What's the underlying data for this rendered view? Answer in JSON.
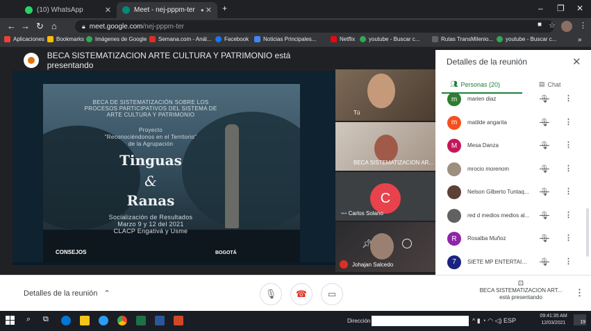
{
  "browser": {
    "tabs": [
      {
        "label": "(10) WhatsApp",
        "favicon_color": "#25d366",
        "active": false
      },
      {
        "label": "Meet - nej-pppm-ter",
        "favicon_color": "#00897b",
        "active": true
      }
    ],
    "new_tab": "+",
    "window_controls": [
      "–",
      "❐",
      "✕"
    ],
    "url_host": "meet.google.com",
    "url_path": "/nej-pppm-ter",
    "bookmarks": [
      {
        "label": "Aplicaciones",
        "color": "#ea4335"
      },
      {
        "label": "Bookmarks",
        "color": "#fbbc04"
      },
      {
        "label": "Imágenes de Google",
        "color": "#34a853"
      },
      {
        "label": "Semana.com - Anál...",
        "color": "#d93025"
      },
      {
        "label": "Facebook",
        "color": "#1877f2"
      },
      {
        "label": "Noticias Principales...",
        "color": "#4285f4"
      },
      {
        "label": "Netflix",
        "color": "#e50914"
      },
      {
        "label": "youtube - Buscar c...",
        "color": "#34a853"
      },
      {
        "label": "Rutas TransMilenio...",
        "color": "#5f6368"
      },
      {
        "label": "youtube - Buscar c...",
        "color": "#34a853"
      }
    ],
    "more_bookmarks": "»"
  },
  "meet": {
    "presenting_banner": "BECA SISTEMATIZACION ARTE CULTURA Y PATRIMONIO está presentando",
    "slide": {
      "line1": "BECA DE SISTEMATIZACIÓN SOBRE LOS",
      "line2": "PROCESOS PARTICIPATIVOS DEL SISTEMA DE",
      "line3": "ARTE CULTURA Y PATRIMONIO",
      "proyecto": "Proyecto",
      "project_name": "\"Reconociéndonos en el Territorio\"",
      "agrupacion": "de la Agrupación",
      "title1": "Tinguas",
      "amp": "&",
      "title2": "Ranas",
      "sub1": "Socialización de Resultados",
      "sub2": "Marzo 9 y 12 del 2021",
      "sub3": "CLACP Engativá y Usme",
      "logo_left": "CONSEJOS",
      "logo_right": "BOGOTÁ"
    },
    "tiles": [
      {
        "name": "Tú"
      },
      {
        "name": "BECA SISTEMATIZACION AR..."
      },
      {
        "name": "Carlos Solano",
        "initial": "C"
      },
      {
        "name": "Johajan Salcedo"
      }
    ],
    "panel": {
      "title": "Detalles de la reunión",
      "people_tab": "Personas (20)",
      "chat_tab": "Chat",
      "participants": [
        {
          "name": "marien diaz",
          "initial": "m",
          "color": "#2e7d32"
        },
        {
          "name": "matilde angarita",
          "initial": "m",
          "color": "#f4511e"
        },
        {
          "name": "Mesa Danza",
          "initial": "M",
          "color": "#c2185b"
        },
        {
          "name": "mrocio morenom",
          "initial": "",
          "color": "#9e8e7e"
        },
        {
          "name": "Nelson Gilberto Tuntaq...",
          "initial": "",
          "color": "#5d4037"
        },
        {
          "name": "red d medios medios al...",
          "initial": "",
          "color": "#616161"
        },
        {
          "name": "Rosalba Muñoz",
          "initial": "R",
          "color": "#8e24aa"
        },
        {
          "name": "SIETE MP ENTERTAINM...",
          "initial": "7",
          "color": "#1a237e"
        }
      ]
    },
    "controls": {
      "details_label": "Detalles de la reunión",
      "presenter_name": "BECA SISTEMATIZACION ART...",
      "presenter_status": "está presentando"
    }
  },
  "taskbar": {
    "address_label": "Dirección",
    "tray_lang": "ESP",
    "time": "09:41:35 AM",
    "date": "12/03/2021",
    "notification_count": "19"
  }
}
